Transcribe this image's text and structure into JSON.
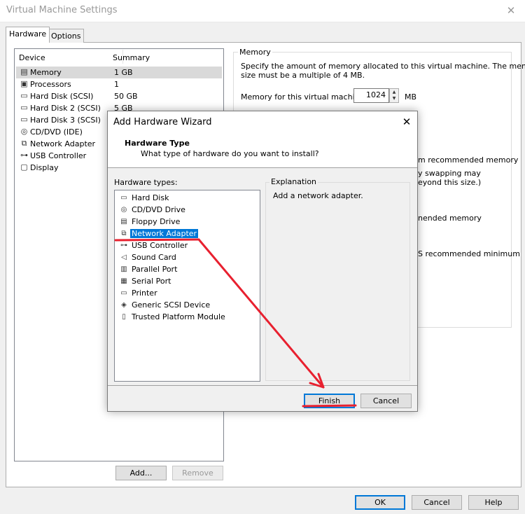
{
  "window": {
    "title": "Virtual Machine Settings",
    "close_glyph": "✕"
  },
  "tabs": [
    {
      "label": "Hardware"
    },
    {
      "label": "Options"
    }
  ],
  "device_list": {
    "columns": {
      "device": "Device",
      "summary": "Summary"
    },
    "items": [
      {
        "name": "Memory",
        "summary": "1 GB",
        "icon": "memory-icon",
        "glyph": "▤"
      },
      {
        "name": "Processors",
        "summary": "1",
        "icon": "processor-icon",
        "glyph": "▣"
      },
      {
        "name": "Hard Disk (SCSI)",
        "summary": "50 GB",
        "icon": "hard-disk-icon",
        "glyph": "▭"
      },
      {
        "name": "Hard Disk 2 (SCSI)",
        "summary": "5 GB",
        "icon": "hard-disk-icon",
        "glyph": "▭"
      },
      {
        "name": "Hard Disk 3 (SCSI)",
        "summary": "",
        "icon": "hard-disk-icon",
        "glyph": "▭"
      },
      {
        "name": "CD/DVD (IDE)",
        "summary": "",
        "icon": "cd-dvd-icon",
        "glyph": "◎"
      },
      {
        "name": "Network Adapter",
        "summary": "",
        "icon": "network-adapter-icon",
        "glyph": "⧉"
      },
      {
        "name": "USB Controller",
        "summary": "",
        "icon": "usb-icon",
        "glyph": "⊶"
      },
      {
        "name": "Display",
        "summary": "",
        "icon": "display-icon",
        "glyph": "▢"
      }
    ],
    "add_label": "Add...",
    "remove_label": "Remove"
  },
  "memory": {
    "group_label": "Memory",
    "desc_line1": "Specify the amount of memory allocated to this virtual machine. The memory",
    "desc_line2": "size must be a multiple of 4 MB.",
    "field_label": "Memory for this virtual machine:",
    "value": "1024",
    "unit": "MB",
    "spin_up": "▲",
    "spin_down": "▼",
    "partial_texts": [
      "m recommended memory",
      "y swapping may",
      "eyond this size.)",
      "nended memory",
      "S recommended minimum"
    ]
  },
  "wizard": {
    "title": "Add Hardware Wizard",
    "close_glyph": "✕",
    "heading": "Hardware Type",
    "subheading": "What type of hardware do you want to install?",
    "types_label": "Hardware types:",
    "types": [
      {
        "name": "Hard Disk",
        "icon": "hard-disk-icon",
        "glyph": "▭"
      },
      {
        "name": "CD/DVD Drive",
        "icon": "cd-dvd-icon",
        "glyph": "◎"
      },
      {
        "name": "Floppy Drive",
        "icon": "floppy-icon",
        "glyph": "▤"
      },
      {
        "name": "Network Adapter",
        "icon": "network-adapter-icon",
        "glyph": "⧉",
        "selected": true
      },
      {
        "name": "USB Controller",
        "icon": "usb-icon",
        "glyph": "⊶"
      },
      {
        "name": "Sound Card",
        "icon": "speaker-icon",
        "glyph": "◁"
      },
      {
        "name": "Parallel Port",
        "icon": "parallel-port-icon",
        "glyph": "▥"
      },
      {
        "name": "Serial Port",
        "icon": "serial-port-icon",
        "glyph": "▦"
      },
      {
        "name": "Printer",
        "icon": "printer-icon",
        "glyph": "▭"
      },
      {
        "name": "Generic SCSI Device",
        "icon": "scsi-icon",
        "glyph": "◈"
      },
      {
        "name": "Trusted Platform Module",
        "icon": "tpm-icon",
        "glyph": "▯"
      }
    ],
    "explanation_label": "Explanation",
    "explanation_text": "Add a network adapter.",
    "finish_label": "Finish",
    "cancel_label": "Cancel"
  },
  "footer": {
    "ok_label": "OK",
    "cancel_label": "Cancel",
    "help_label": "Help"
  },
  "annotation_color": "#e8202f"
}
